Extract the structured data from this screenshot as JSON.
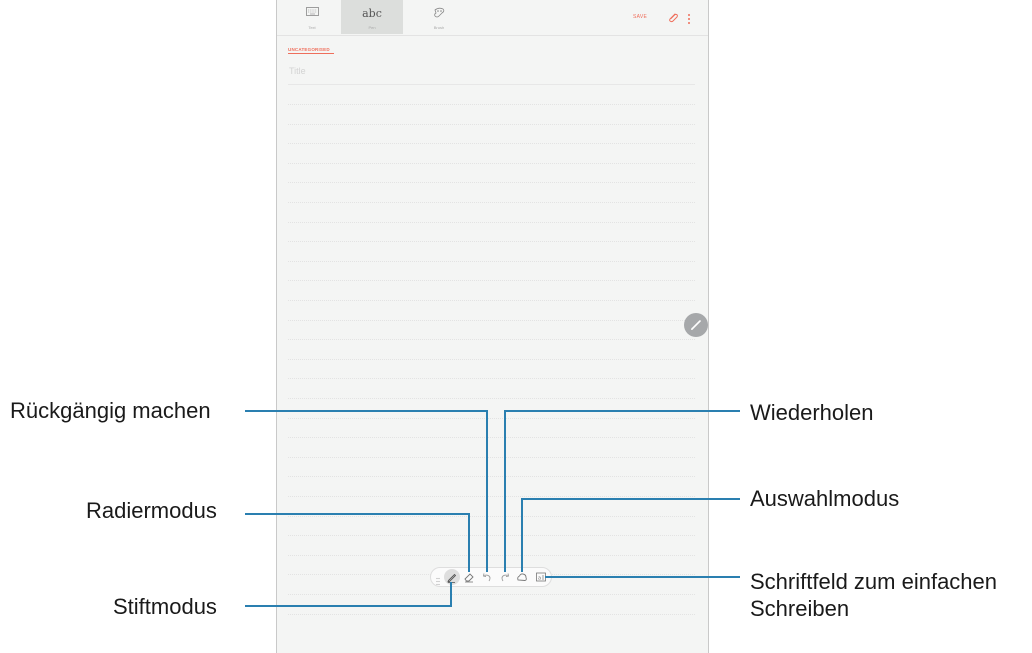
{
  "app": {
    "tabs": [
      {
        "name": "Text",
        "label": "Text",
        "icon": "keyboard-icon"
      },
      {
        "name": "Pen",
        "label": "Pen",
        "icon_text": "abc",
        "selected": true
      },
      {
        "name": "Brush",
        "label": "Brush",
        "icon": "brush-icon"
      }
    ],
    "save_label": "SAVE",
    "category_label": "UNCATEGORISED",
    "title_placeholder": "Title",
    "accent_color": "#ef6e5b"
  },
  "toolbar": {
    "tools": [
      "pen-mode-icon",
      "eraser-icon",
      "undo-icon",
      "redo-icon",
      "selection-icon",
      "textbox-icon"
    ]
  },
  "callouts": {
    "undo": "Rückgängig machen",
    "eraser": "Radiermodus",
    "pen": "Stiftmodus",
    "redo": "Wiederholen",
    "selection": "Auswahlmodus",
    "textbox_line1": "Schriftfeld zum einfachen",
    "textbox_line2": "Schreiben"
  },
  "callout_line_color": "#2a7fb0"
}
